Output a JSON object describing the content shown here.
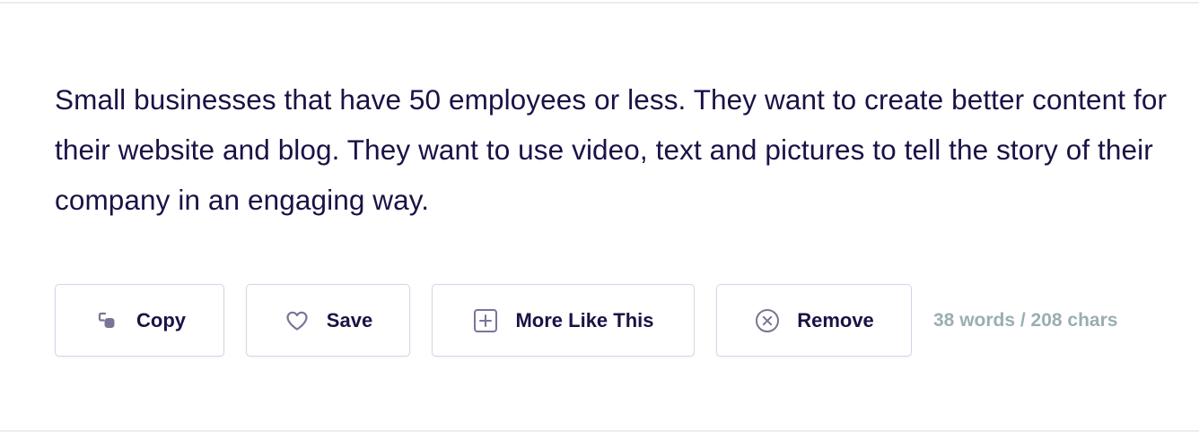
{
  "content": {
    "text": "Small businesses that have 50 employees or less. They want to create better content for their website and blog. They want to use video, text and pictures to tell the story of their company in an engaging way."
  },
  "actions": {
    "copy_label": "Copy",
    "save_label": "Save",
    "more_label": "More Like This",
    "remove_label": "Remove"
  },
  "stats": {
    "counts": "38 words / 208 chars"
  },
  "icons": {
    "copy": "copy-icon",
    "save": "heart-icon",
    "more": "plus-square-icon",
    "remove": "x-circle-icon"
  },
  "colors": {
    "text": "#1c1146",
    "icon": "#7c7398",
    "border": "#d6d3e8",
    "muted": "#9aaeb2"
  }
}
